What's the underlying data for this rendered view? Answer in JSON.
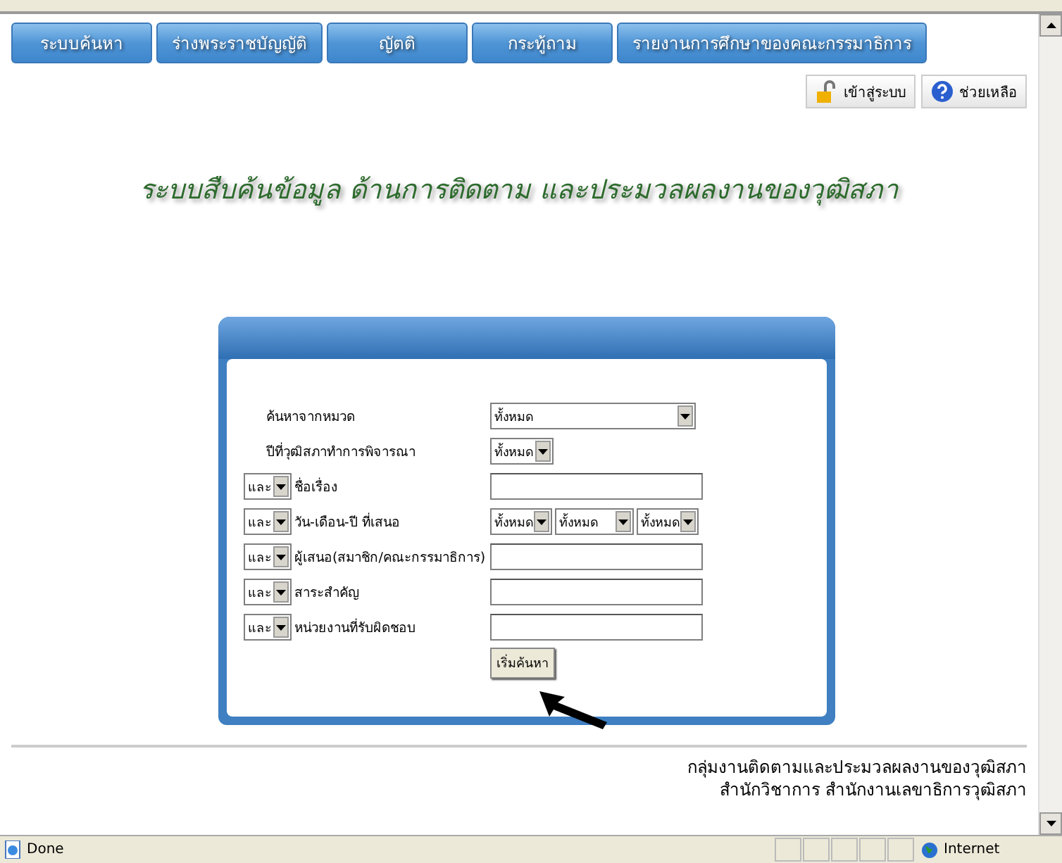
{
  "nav_tabs": [
    {
      "label": "ระบบค้นหา"
    },
    {
      "label": "ร่างพระราชบัญญัติ"
    },
    {
      "label": "ญัตติ"
    },
    {
      "label": "กระทู้ถาม"
    },
    {
      "label": "รายงานการศึกษาของคณะกรรมาธิการ"
    }
  ],
  "top_buttons": [
    {
      "kind": "login",
      "label": "เข้าสู่ระบบ"
    },
    {
      "kind": "help",
      "label": "ช่วยเหลือ"
    }
  ],
  "title": "ระบบสืบค้นข้อมูล ด้านการติดตาม และประมวลผลงานของวุฒิสภา",
  "form": {
    "rows": [
      {
        "kind": "dropdown",
        "label": "ค้นหาจากหมวด",
        "values": [
          "ทั้งหมด"
        ]
      },
      {
        "kind": "compact",
        "label": "ปีที่วุฒิสภาทำการพิจารณา",
        "values": [
          "ทั้งหมด"
        ]
      },
      {
        "kind": "text",
        "connector": "และ",
        "label": "ชื่อเรื่อง"
      },
      {
        "kind": "date",
        "connector": "และ",
        "label": "วัน-เดือน-ปี ที่เสนอ",
        "values": [
          "ทั้งหมด",
          "ทั้งหมด",
          "ทั้งหมด"
        ]
      },
      {
        "kind": "text",
        "connector": "และ",
        "label": "ผู้เสนอ(สมาชิก/คณะกรรมาธิการ)"
      },
      {
        "kind": "text",
        "connector": "และ",
        "label": "สาระสำคัญ"
      },
      {
        "kind": "text",
        "connector": "และ",
        "label": "หน่วยงานที่รับผิดชอบ"
      }
    ],
    "submit": "เริ่มค้นหา"
  },
  "footer": [
    "กลุ่มงานติดตามและประมวลผลงานของวุฒิสภา",
    "สำนักวิชาการ สำนักงานเลขาธิการวุฒิสภา"
  ],
  "status_bar": {
    "text": "Done",
    "zone": "Internet"
  }
}
